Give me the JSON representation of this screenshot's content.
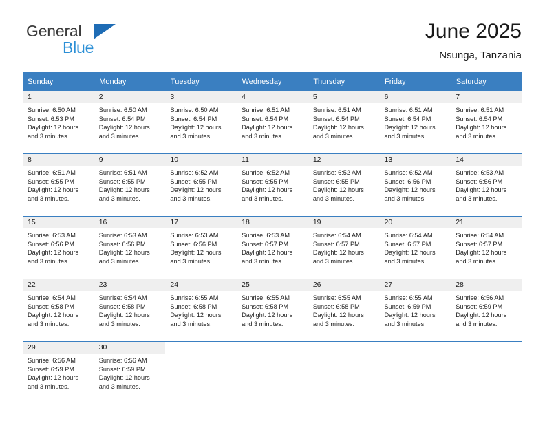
{
  "brand": {
    "name_part1": "General",
    "name_part2": "Blue",
    "triangle_color": "#1e6cb5",
    "blue_text_color": "#2b8fd6"
  },
  "header": {
    "title": "June 2025",
    "subtitle": "Nsunga, Tanzania"
  },
  "theme": {
    "header_band": "#3a7fc1",
    "daynum_strip": "#efefef",
    "row_divider": "#3a7fc1"
  },
  "calendar": {
    "weekday_headers": [
      "Sunday",
      "Monday",
      "Tuesday",
      "Wednesday",
      "Thursday",
      "Friday",
      "Saturday"
    ],
    "labels": {
      "sunrise": "Sunrise:",
      "sunset": "Sunset:",
      "daylight": "Daylight:"
    },
    "weeks": [
      [
        {
          "day": "1",
          "sunrise": "Sunrise: 6:50 AM",
          "sunset": "Sunset: 6:53 PM",
          "daylight1": "Daylight: 12 hours",
          "daylight2": "and 3 minutes."
        },
        {
          "day": "2",
          "sunrise": "Sunrise: 6:50 AM",
          "sunset": "Sunset: 6:54 PM",
          "daylight1": "Daylight: 12 hours",
          "daylight2": "and 3 minutes."
        },
        {
          "day": "3",
          "sunrise": "Sunrise: 6:50 AM",
          "sunset": "Sunset: 6:54 PM",
          "daylight1": "Daylight: 12 hours",
          "daylight2": "and 3 minutes."
        },
        {
          "day": "4",
          "sunrise": "Sunrise: 6:51 AM",
          "sunset": "Sunset: 6:54 PM",
          "daylight1": "Daylight: 12 hours",
          "daylight2": "and 3 minutes."
        },
        {
          "day": "5",
          "sunrise": "Sunrise: 6:51 AM",
          "sunset": "Sunset: 6:54 PM",
          "daylight1": "Daylight: 12 hours",
          "daylight2": "and 3 minutes."
        },
        {
          "day": "6",
          "sunrise": "Sunrise: 6:51 AM",
          "sunset": "Sunset: 6:54 PM",
          "daylight1": "Daylight: 12 hours",
          "daylight2": "and 3 minutes."
        },
        {
          "day": "7",
          "sunrise": "Sunrise: 6:51 AM",
          "sunset": "Sunset: 6:54 PM",
          "daylight1": "Daylight: 12 hours",
          "daylight2": "and 3 minutes."
        }
      ],
      [
        {
          "day": "8",
          "sunrise": "Sunrise: 6:51 AM",
          "sunset": "Sunset: 6:55 PM",
          "daylight1": "Daylight: 12 hours",
          "daylight2": "and 3 minutes."
        },
        {
          "day": "9",
          "sunrise": "Sunrise: 6:51 AM",
          "sunset": "Sunset: 6:55 PM",
          "daylight1": "Daylight: 12 hours",
          "daylight2": "and 3 minutes."
        },
        {
          "day": "10",
          "sunrise": "Sunrise: 6:52 AM",
          "sunset": "Sunset: 6:55 PM",
          "daylight1": "Daylight: 12 hours",
          "daylight2": "and 3 minutes."
        },
        {
          "day": "11",
          "sunrise": "Sunrise: 6:52 AM",
          "sunset": "Sunset: 6:55 PM",
          "daylight1": "Daylight: 12 hours",
          "daylight2": "and 3 minutes."
        },
        {
          "day": "12",
          "sunrise": "Sunrise: 6:52 AM",
          "sunset": "Sunset: 6:55 PM",
          "daylight1": "Daylight: 12 hours",
          "daylight2": "and 3 minutes."
        },
        {
          "day": "13",
          "sunrise": "Sunrise: 6:52 AM",
          "sunset": "Sunset: 6:56 PM",
          "daylight1": "Daylight: 12 hours",
          "daylight2": "and 3 minutes."
        },
        {
          "day": "14",
          "sunrise": "Sunrise: 6:53 AM",
          "sunset": "Sunset: 6:56 PM",
          "daylight1": "Daylight: 12 hours",
          "daylight2": "and 3 minutes."
        }
      ],
      [
        {
          "day": "15",
          "sunrise": "Sunrise: 6:53 AM",
          "sunset": "Sunset: 6:56 PM",
          "daylight1": "Daylight: 12 hours",
          "daylight2": "and 3 minutes."
        },
        {
          "day": "16",
          "sunrise": "Sunrise: 6:53 AM",
          "sunset": "Sunset: 6:56 PM",
          "daylight1": "Daylight: 12 hours",
          "daylight2": "and 3 minutes."
        },
        {
          "day": "17",
          "sunrise": "Sunrise: 6:53 AM",
          "sunset": "Sunset: 6:56 PM",
          "daylight1": "Daylight: 12 hours",
          "daylight2": "and 3 minutes."
        },
        {
          "day": "18",
          "sunrise": "Sunrise: 6:53 AM",
          "sunset": "Sunset: 6:57 PM",
          "daylight1": "Daylight: 12 hours",
          "daylight2": "and 3 minutes."
        },
        {
          "day": "19",
          "sunrise": "Sunrise: 6:54 AM",
          "sunset": "Sunset: 6:57 PM",
          "daylight1": "Daylight: 12 hours",
          "daylight2": "and 3 minutes."
        },
        {
          "day": "20",
          "sunrise": "Sunrise: 6:54 AM",
          "sunset": "Sunset: 6:57 PM",
          "daylight1": "Daylight: 12 hours",
          "daylight2": "and 3 minutes."
        },
        {
          "day": "21",
          "sunrise": "Sunrise: 6:54 AM",
          "sunset": "Sunset: 6:57 PM",
          "daylight1": "Daylight: 12 hours",
          "daylight2": "and 3 minutes."
        }
      ],
      [
        {
          "day": "22",
          "sunrise": "Sunrise: 6:54 AM",
          "sunset": "Sunset: 6:58 PM",
          "daylight1": "Daylight: 12 hours",
          "daylight2": "and 3 minutes."
        },
        {
          "day": "23",
          "sunrise": "Sunrise: 6:54 AM",
          "sunset": "Sunset: 6:58 PM",
          "daylight1": "Daylight: 12 hours",
          "daylight2": "and 3 minutes."
        },
        {
          "day": "24",
          "sunrise": "Sunrise: 6:55 AM",
          "sunset": "Sunset: 6:58 PM",
          "daylight1": "Daylight: 12 hours",
          "daylight2": "and 3 minutes."
        },
        {
          "day": "25",
          "sunrise": "Sunrise: 6:55 AM",
          "sunset": "Sunset: 6:58 PM",
          "daylight1": "Daylight: 12 hours",
          "daylight2": "and 3 minutes."
        },
        {
          "day": "26",
          "sunrise": "Sunrise: 6:55 AM",
          "sunset": "Sunset: 6:58 PM",
          "daylight1": "Daylight: 12 hours",
          "daylight2": "and 3 minutes."
        },
        {
          "day": "27",
          "sunrise": "Sunrise: 6:55 AM",
          "sunset": "Sunset: 6:59 PM",
          "daylight1": "Daylight: 12 hours",
          "daylight2": "and 3 minutes."
        },
        {
          "day": "28",
          "sunrise": "Sunrise: 6:56 AM",
          "sunset": "Sunset: 6:59 PM",
          "daylight1": "Daylight: 12 hours",
          "daylight2": "and 3 minutes."
        }
      ],
      [
        {
          "day": "29",
          "sunrise": "Sunrise: 6:56 AM",
          "sunset": "Sunset: 6:59 PM",
          "daylight1": "Daylight: 12 hours",
          "daylight2": "and 3 minutes."
        },
        {
          "day": "30",
          "sunrise": "Sunrise: 6:56 AM",
          "sunset": "Sunset: 6:59 PM",
          "daylight1": "Daylight: 12 hours",
          "daylight2": "and 3 minutes."
        },
        {
          "day": "",
          "sunrise": "",
          "sunset": "",
          "daylight1": "",
          "daylight2": ""
        },
        {
          "day": "",
          "sunrise": "",
          "sunset": "",
          "daylight1": "",
          "daylight2": ""
        },
        {
          "day": "",
          "sunrise": "",
          "sunset": "",
          "daylight1": "",
          "daylight2": ""
        },
        {
          "day": "",
          "sunrise": "",
          "sunset": "",
          "daylight1": "",
          "daylight2": ""
        },
        {
          "day": "",
          "sunrise": "",
          "sunset": "",
          "daylight1": "",
          "daylight2": ""
        }
      ]
    ]
  }
}
